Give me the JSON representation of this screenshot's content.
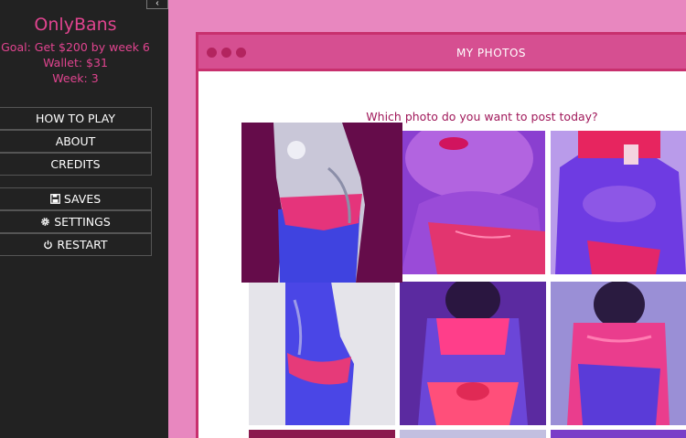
{
  "sidebar": {
    "title": "OnlyBans",
    "goal": "Goal: Get $200 by week 6",
    "wallet": "Wallet: $31",
    "week": "Week: 3",
    "collapse_icon": "chevron-left-icon",
    "menu": [
      {
        "label": "HOW TO PLAY"
      },
      {
        "label": "ABOUT"
      },
      {
        "label": "CREDITS"
      }
    ],
    "actions": [
      {
        "label": "SAVES",
        "icon": "floppy-disk-icon"
      },
      {
        "label": "SETTINGS",
        "icon": "gear-icon"
      },
      {
        "label": "RESTART",
        "icon": "power-icon"
      }
    ]
  },
  "window": {
    "title": "MY PHOTOS",
    "prompt": "Which photo do you want to post today?"
  },
  "colors": {
    "background": "#e887bf",
    "sidebar": "#222222",
    "accent": "#e0448f",
    "titlebar": "#d64f91",
    "border": "#c8306e",
    "prompt": "#a0185a"
  }
}
